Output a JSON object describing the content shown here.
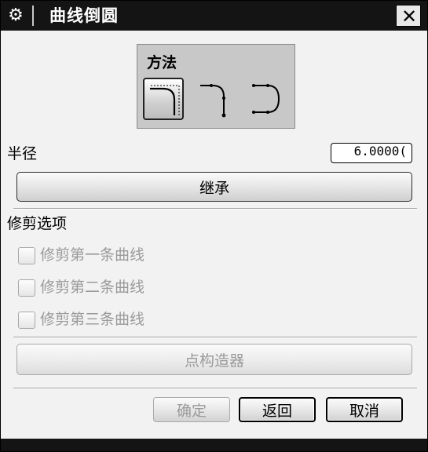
{
  "window": {
    "title": "曲线倒圆",
    "gear_icon": "gear-icon",
    "close_label": "✕"
  },
  "method": {
    "label": "方法",
    "options": [
      {
        "icon": "fillet-simple-icon",
        "selected": true
      },
      {
        "icon": "fillet-two-curves-icon",
        "selected": false
      },
      {
        "icon": "fillet-three-curves-icon",
        "selected": false
      }
    ]
  },
  "radius": {
    "label": "半径",
    "value": "6.00000",
    "display_value": "6.0000("
  },
  "inherit_button": "继承",
  "trim": {
    "label": "修剪选项",
    "options": [
      {
        "label": "修剪第一条曲线",
        "checked": false,
        "enabled": false
      },
      {
        "label": "修剪第二条曲线",
        "checked": false,
        "enabled": false
      },
      {
        "label": "修剪第三条曲线",
        "checked": false,
        "enabled": false
      }
    ]
  },
  "point_constructor_button": "点构造器",
  "buttons": {
    "ok": "确定",
    "back": "返回",
    "cancel": "取消"
  },
  "colors": {
    "titlebar": "#141414",
    "dialog_bg": "#f2f2f2",
    "method_panel": "#c8c8c8",
    "disabled_text": "#9a9a9a"
  }
}
